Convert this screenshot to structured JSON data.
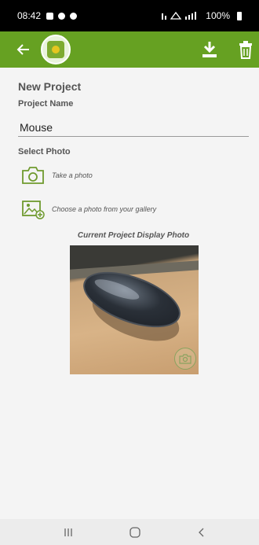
{
  "status_bar": {
    "time": "08:42",
    "battery": "100%"
  },
  "app_bar": {
    "background_color": "#66a122",
    "back_icon": "arrow-left-icon",
    "logo_icon": "app-logo-icon",
    "download_icon": "download-icon",
    "delete_icon": "trash-icon"
  },
  "form": {
    "title": "New Project",
    "project_name_label": "Project Name",
    "project_name_value": "Mouse",
    "select_photo_label": "Select Photo",
    "take_photo_label": "Take a photo",
    "gallery_label": "Choose a photo from your gallery",
    "current_photo_caption": "Current Project Display Photo"
  },
  "nav_bar": {
    "recents_icon": "recents-icon",
    "home_icon": "home-icon",
    "back_icon": "nav-back-icon"
  }
}
